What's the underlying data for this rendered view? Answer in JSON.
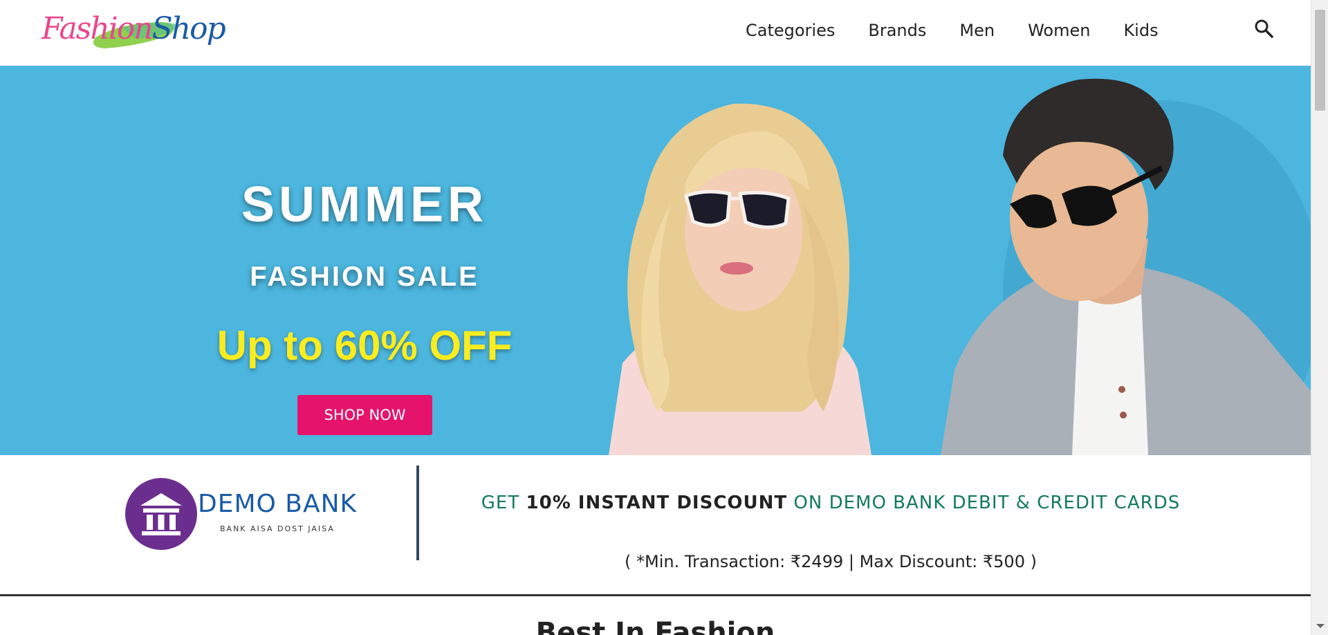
{
  "brand": {
    "logo_part1": "Fashion",
    "logo_part2": "Shop"
  },
  "nav": {
    "items": [
      {
        "label": "Categories"
      },
      {
        "label": "Brands"
      },
      {
        "label": "Men"
      },
      {
        "label": "Women"
      },
      {
        "label": "Kids"
      }
    ],
    "search_icon": "search-icon"
  },
  "hero": {
    "title": "SUMMER",
    "subtitle": "FASHION SALE",
    "offer": "Up to 60% OFF",
    "cta_label": "SHOP NOW",
    "background_color": "#4cb6de",
    "offer_color": "#f9ec1f",
    "cta_color": "#e5136b"
  },
  "bank_offer": {
    "bank_name": "DEMO BANK",
    "bank_tagline": "BANK AISA DOST JAISA",
    "bank_icon": "bank-icon",
    "offer_prefix": "GET ",
    "offer_highlight": "10% INSTANT DISCOUNT",
    "offer_suffix": " ON DEMO BANK DEBIT & CREDIT CARDS",
    "terms": "( *Min. Transaction: ₹2499 | Max Discount: ₹500 )",
    "accent_color": "#137a5a",
    "bank_color": "#6b2e8e"
  },
  "section": {
    "title": "Best In Fashion"
  }
}
